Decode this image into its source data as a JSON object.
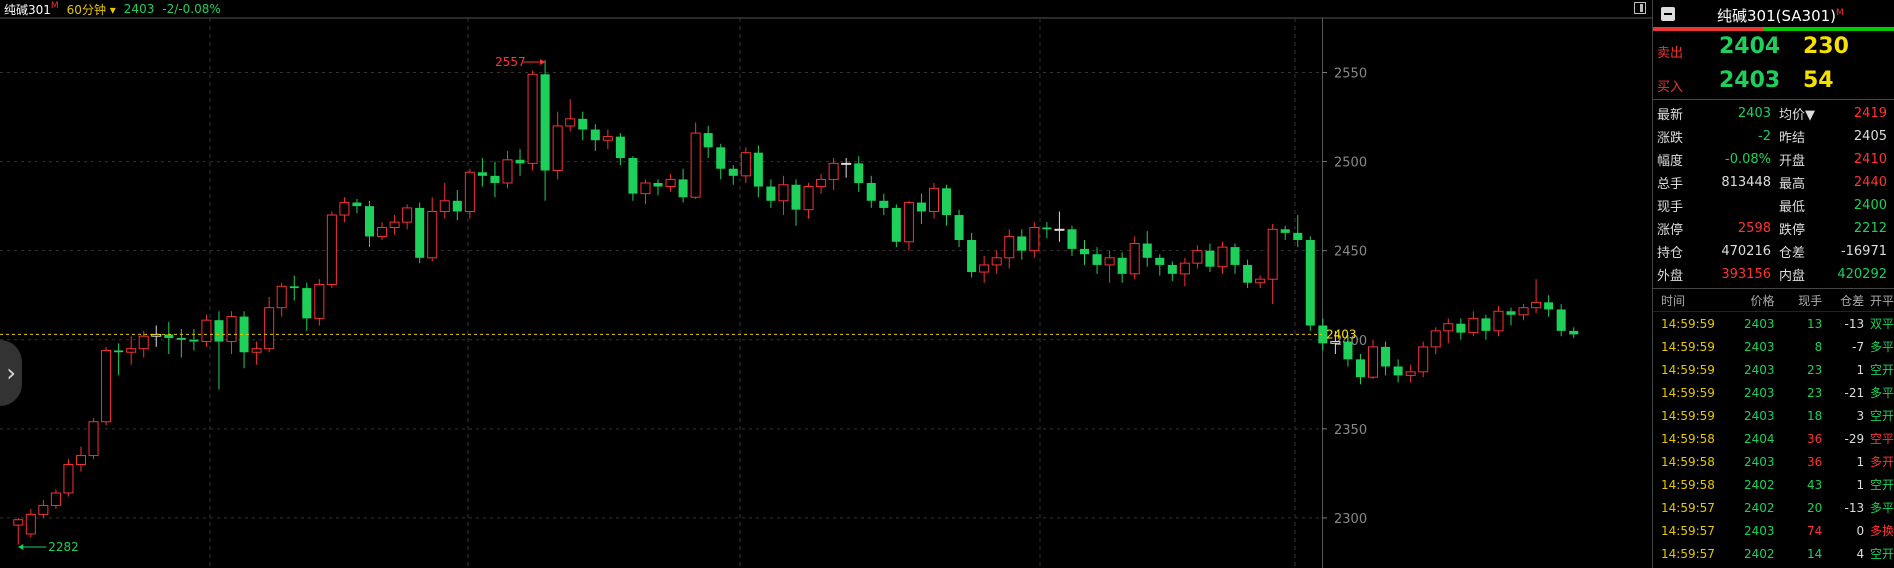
{
  "header": {
    "symbol": "纯碱301",
    "symbol_sup": "M",
    "period": "60分钟",
    "last": "2403",
    "change": "-2/-0.08%"
  },
  "colors": {
    "up": "#f33333",
    "down": "#1ed05a",
    "grid": "#333333",
    "axis": "#888888",
    "price_line": "#e6c700"
  },
  "chart_data": {
    "type": "candlestick",
    "ylim": [
      2282,
      2566
    ],
    "yticks": [
      2300,
      2350,
      2400,
      2450,
      2500,
      2550
    ],
    "current_price": 2403,
    "current_price_label": "2403",
    "high_marker": {
      "value": 2557,
      "label": "2557"
    },
    "low_marker": {
      "value": 2282,
      "label": "2282"
    },
    "candles": [
      [
        2296,
        2299,
        2285,
        2300
      ],
      [
        2291,
        2302,
        2289,
        2305
      ],
      [
        2302,
        2307,
        2300,
        2310
      ],
      [
        2307,
        2314,
        2305,
        2316
      ],
      [
        2314,
        2330,
        2312,
        2333
      ],
      [
        2330,
        2335,
        2326,
        2340
      ],
      [
        2335,
        2354,
        2333,
        2356
      ],
      [
        2354,
        2394,
        2352,
        2396
      ],
      [
        2394,
        2393,
        2380,
        2398
      ],
      [
        2393,
        2395,
        2386,
        2402
      ],
      [
        2395,
        2402,
        2390,
        2405
      ],
      [
        2402,
        2403,
        2396,
        2408
      ],
      [
        2403,
        2401,
        2392,
        2410
      ],
      [
        2401,
        2400,
        2390,
        2406
      ],
      [
        2400,
        2399,
        2394,
        2406
      ],
      [
        2399,
        2411,
        2396,
        2414
      ],
      [
        2411,
        2399,
        2372,
        2416
      ],
      [
        2399,
        2413,
        2392,
        2416
      ],
      [
        2413,
        2393,
        2384,
        2416
      ],
      [
        2393,
        2395,
        2386,
        2399
      ],
      [
        2395,
        2418,
        2393,
        2424
      ],
      [
        2418,
        2430,
        2413,
        2432
      ],
      [
        2430,
        2429,
        2422,
        2436
      ],
      [
        2429,
        2412,
        2405,
        2432
      ],
      [
        2412,
        2431,
        2408,
        2434
      ],
      [
        2431,
        2470,
        2429,
        2472
      ],
      [
        2470,
        2477,
        2466,
        2480
      ],
      [
        2477,
        2475,
        2471,
        2479
      ],
      [
        2475,
        2458,
        2452,
        2478
      ],
      [
        2458,
        2463,
        2456,
        2466
      ],
      [
        2463,
        2466,
        2459,
        2470
      ],
      [
        2466,
        2474,
        2462,
        2476
      ],
      [
        2474,
        2446,
        2443,
        2477
      ],
      [
        2446,
        2472,
        2444,
        2480
      ],
      [
        2472,
        2478,
        2468,
        2488
      ],
      [
        2478,
        2472,
        2467,
        2484
      ],
      [
        2472,
        2494,
        2468,
        2496
      ],
      [
        2494,
        2492,
        2486,
        2502
      ],
      [
        2492,
        2488,
        2480,
        2500
      ],
      [
        2488,
        2501,
        2485,
        2506
      ],
      [
        2501,
        2499,
        2492,
        2507
      ],
      [
        2499,
        2549,
        2495,
        2551
      ],
      [
        2549,
        2495,
        2478,
        2557
      ],
      [
        2495,
        2520,
        2490,
        2528
      ],
      [
        2520,
        2524,
        2517,
        2535
      ],
      [
        2524,
        2518,
        2512,
        2528
      ],
      [
        2518,
        2512,
        2506,
        2521
      ],
      [
        2512,
        2514,
        2507,
        2518
      ],
      [
        2514,
        2502,
        2498,
        2516
      ],
      [
        2502,
        2482,
        2478,
        2503
      ],
      [
        2482,
        2488,
        2476,
        2490
      ],
      [
        2488,
        2486,
        2481,
        2490
      ],
      [
        2486,
        2490,
        2483,
        2493
      ],
      [
        2490,
        2480,
        2477,
        2496
      ],
      [
        2480,
        2516,
        2479,
        2522
      ],
      [
        2516,
        2508,
        2502,
        2520
      ],
      [
        2508,
        2496,
        2490,
        2510
      ],
      [
        2496,
        2492,
        2487,
        2498
      ],
      [
        2492,
        2505,
        2488,
        2508
      ],
      [
        2505,
        2486,
        2480,
        2509
      ],
      [
        2486,
        2478,
        2474,
        2490
      ],
      [
        2478,
        2487,
        2470,
        2492
      ],
      [
        2487,
        2473,
        2464,
        2490
      ],
      [
        2473,
        2486,
        2468,
        2488
      ],
      [
        2486,
        2490,
        2482,
        2493
      ],
      [
        2490,
        2499,
        2484,
        2502
      ],
      [
        2499,
        2499,
        2491,
        2502
      ],
      [
        2499,
        2488,
        2483,
        2503
      ],
      [
        2488,
        2478,
        2474,
        2492
      ],
      [
        2478,
        2474,
        2470,
        2482
      ],
      [
        2474,
        2455,
        2452,
        2476
      ],
      [
        2455,
        2477,
        2450,
        2478
      ],
      [
        2477,
        2472,
        2465,
        2482
      ],
      [
        2472,
        2485,
        2468,
        2488
      ],
      [
        2485,
        2470,
        2464,
        2487
      ],
      [
        2470,
        2456,
        2452,
        2473
      ],
      [
        2456,
        2438,
        2435,
        2460
      ],
      [
        2438,
        2442,
        2432,
        2447
      ],
      [
        2442,
        2446,
        2437,
        2450
      ],
      [
        2446,
        2458,
        2440,
        2462
      ],
      [
        2458,
        2450,
        2445,
        2462
      ],
      [
        2450,
        2463,
        2446,
        2466
      ],
      [
        2463,
        2462,
        2457,
        2466
      ],
      [
        2462,
        2462,
        2455,
        2472
      ],
      [
        2462,
        2451,
        2447,
        2464
      ],
      [
        2451,
        2448,
        2442,
        2456
      ],
      [
        2448,
        2442,
        2437,
        2452
      ],
      [
        2442,
        2446,
        2432,
        2450
      ],
      [
        2446,
        2437,
        2432,
        2449
      ],
      [
        2437,
        2454,
        2434,
        2458
      ],
      [
        2454,
        2446,
        2441,
        2461
      ],
      [
        2446,
        2442,
        2436,
        2448
      ],
      [
        2442,
        2437,
        2433,
        2444
      ],
      [
        2437,
        2443,
        2430,
        2446
      ],
      [
        2443,
        2450,
        2440,
        2453
      ],
      [
        2450,
        2441,
        2438,
        2454
      ],
      [
        2441,
        2452,
        2437,
        2455
      ],
      [
        2452,
        2442,
        2437,
        2454
      ],
      [
        2442,
        2432,
        2429,
        2445
      ],
      [
        2432,
        2434,
        2429,
        2436
      ],
      [
        2434,
        2462,
        2420,
        2465
      ],
      [
        2462,
        2460,
        2456,
        2464
      ],
      [
        2460,
        2456,
        2452,
        2470
      ],
      [
        2456,
        2408,
        2405,
        2458
      ],
      [
        2408,
        2398,
        2394,
        2412
      ],
      [
        2398,
        2399,
        2392,
        2405
      ],
      [
        2399,
        2389,
        2385,
        2401
      ],
      [
        2389,
        2379,
        2375,
        2392
      ],
      [
        2379,
        2396,
        2378,
        2400
      ],
      [
        2396,
        2385,
        2380,
        2399
      ],
      [
        2385,
        2380,
        2376,
        2389
      ],
      [
        2380,
        2382,
        2376,
        2386
      ],
      [
        2382,
        2396,
        2379,
        2399
      ],
      [
        2396,
        2405,
        2392,
        2407
      ],
      [
        2405,
        2409,
        2398,
        2412
      ],
      [
        2409,
        2404,
        2400,
        2412
      ],
      [
        2404,
        2412,
        2402,
        2416
      ],
      [
        2412,
        2405,
        2400,
        2414
      ],
      [
        2405,
        2416,
        2402,
        2419
      ],
      [
        2416,
        2414,
        2408,
        2418
      ],
      [
        2414,
        2418,
        2411,
        2420
      ],
      [
        2418,
        2421,
        2415,
        2434
      ],
      [
        2421,
        2417,
        2413,
        2425
      ],
      [
        2417,
        2405,
        2402,
        2420
      ],
      [
        2405,
        2403,
        2401,
        2407
      ]
    ]
  },
  "panel": {
    "title": "纯碱301(SA301)",
    "title_sup": "M",
    "sell": {
      "label": "卖出",
      "price": "2404",
      "volume": "230"
    },
    "buy": {
      "label": "买入",
      "price": "2403",
      "volume": "54"
    },
    "stats": [
      {
        "l1": "最新",
        "v1": "2403",
        "c1": "grn",
        "l2": "均价▼",
        "v2": "2419",
        "c2": "red"
      },
      {
        "l1": "涨跌",
        "v1": "-2",
        "c1": "grn",
        "l2": "昨结",
        "v2": "2405",
        "c2": "wht"
      },
      {
        "l1": "幅度",
        "v1": "-0.08%",
        "c1": "grn",
        "l2": "开盘",
        "v2": "2410",
        "c2": "red"
      },
      {
        "l1": "总手",
        "v1": "813448",
        "c1": "wht",
        "l2": "最高",
        "v2": "2440",
        "c2": "red"
      },
      {
        "l1": "现手",
        "v1": "",
        "c1": "wht",
        "l2": "最低",
        "v2": "2400",
        "c2": "grn"
      },
      {
        "l1": "涨停",
        "v1": "2598",
        "c1": "red",
        "l2": "跌停",
        "v2": "2212",
        "c2": "grn"
      },
      {
        "l1": "持仓",
        "v1": "470216",
        "c1": "wht",
        "l2": "仓差",
        "v2": "-16971",
        "c2": "wht"
      },
      {
        "l1": "外盘",
        "v1": "393156",
        "c1": "red",
        "l2": "内盘",
        "v2": "420292",
        "c2": "grn"
      }
    ],
    "ticks_header": [
      "时间",
      "价格",
      "现手",
      "仓差",
      "开平"
    ],
    "ticks": [
      {
        "time": "14:59:59",
        "price": "2403",
        "vol": "13",
        "oi": "-13",
        "type": "双平",
        "pc": "grn",
        "vc": "grn",
        "tc": "grn"
      },
      {
        "time": "14:59:59",
        "price": "2403",
        "vol": "8",
        "oi": "-7",
        "type": "多平",
        "pc": "grn",
        "vc": "grn",
        "tc": "grn"
      },
      {
        "time": "14:59:59",
        "price": "2403",
        "vol": "23",
        "oi": "1",
        "type": "空开",
        "pc": "grn",
        "vc": "grn",
        "tc": "grn"
      },
      {
        "time": "14:59:59",
        "price": "2403",
        "vol": "23",
        "oi": "-21",
        "type": "多平",
        "pc": "grn",
        "vc": "grn",
        "tc": "grn"
      },
      {
        "time": "14:59:59",
        "price": "2403",
        "vol": "18",
        "oi": "3",
        "type": "空开",
        "pc": "grn",
        "vc": "grn",
        "tc": "grn"
      },
      {
        "time": "14:59:58",
        "price": "2404",
        "vol": "36",
        "oi": "-29",
        "type": "空平",
        "pc": "grn",
        "vc": "red",
        "tc": "red"
      },
      {
        "time": "14:59:58",
        "price": "2403",
        "vol": "36",
        "oi": "1",
        "type": "多开",
        "pc": "grn",
        "vc": "red",
        "tc": "red"
      },
      {
        "time": "14:59:58",
        "price": "2402",
        "vol": "43",
        "oi": "1",
        "type": "空开",
        "pc": "grn",
        "vc": "grn",
        "tc": "grn"
      },
      {
        "time": "14:59:57",
        "price": "2402",
        "vol": "20",
        "oi": "-13",
        "type": "多平",
        "pc": "grn",
        "vc": "grn",
        "tc": "grn"
      },
      {
        "time": "14:59:57",
        "price": "2403",
        "vol": "74",
        "oi": "0",
        "type": "多换",
        "pc": "grn",
        "vc": "red",
        "tc": "red"
      },
      {
        "time": "14:59:57",
        "price": "2402",
        "vol": "14",
        "oi": "4",
        "type": "空开",
        "pc": "grn",
        "vc": "grn",
        "tc": "grn"
      }
    ]
  }
}
